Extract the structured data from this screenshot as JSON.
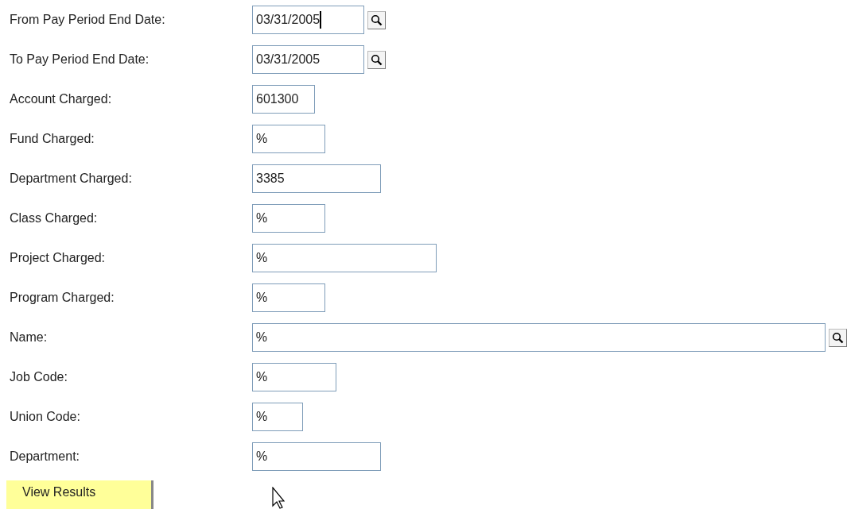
{
  "fields": [
    {
      "label": "From Pay Period End Date:",
      "value": "03/31/2005",
      "lookup": true,
      "focused": true
    },
    {
      "label": "To Pay Period End Date:",
      "value": "03/31/2005",
      "lookup": true,
      "focused": false
    },
    {
      "label": "Account Charged:",
      "value": "601300",
      "lookup": false,
      "focused": false
    },
    {
      "label": "Fund Charged:",
      "value": "%",
      "lookup": false,
      "focused": false
    },
    {
      "label": "Department Charged:",
      "value": "3385",
      "lookup": false,
      "focused": false
    },
    {
      "label": "Class Charged:",
      "value": "%",
      "lookup": false,
      "focused": false
    },
    {
      "label": "Project Charged:",
      "value": "%",
      "lookup": false,
      "focused": false
    },
    {
      "label": "Program Charged:",
      "value": "%",
      "lookup": false,
      "focused": false
    },
    {
      "label": "Name:",
      "value": "%",
      "lookup": true,
      "focused": false
    },
    {
      "label": "Job Code:",
      "value": "%",
      "lookup": false,
      "focused": false
    },
    {
      "label": "Union Code:",
      "value": "%",
      "lookup": false,
      "focused": false
    },
    {
      "label": "Department:",
      "value": "%",
      "lookup": false,
      "focused": false
    }
  ],
  "button": "View Results"
}
